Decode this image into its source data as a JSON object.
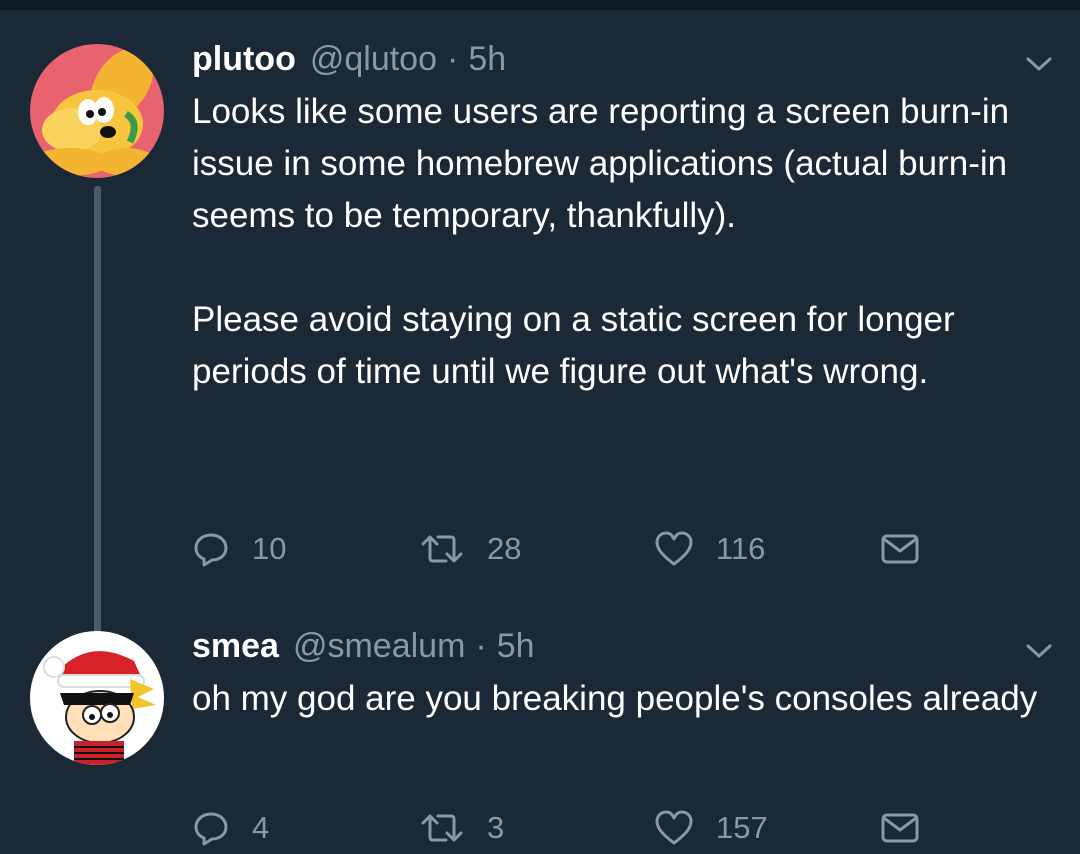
{
  "theme": {
    "background": "#1b2836",
    "text": "#ffffff",
    "muted": "#8899a6",
    "thread_line": "#4b5b6c"
  },
  "tweets": [
    {
      "display_name": "plutoo",
      "handle": "@qlutoo",
      "separator": "·",
      "time": "5h",
      "avatar_icon": "pluto-dog-avatar",
      "text": "Looks like some users are reporting a screen burn-in issue in some homebrew applications (actual burn-in seems to be temporary, thankfully).\n\nPlease avoid staying on a static screen for longer periods of time until we figure out what's wrong.",
      "replies": "10",
      "retweets": "28",
      "likes": "116"
    },
    {
      "display_name": "smea",
      "handle": "@smealum",
      "separator": "·",
      "time": "5h",
      "avatar_icon": "calvin-santa-hat-avatar",
      "text": "oh my god are you breaking people's consoles already",
      "replies": "4",
      "retweets": "3",
      "likes": "157"
    }
  ]
}
